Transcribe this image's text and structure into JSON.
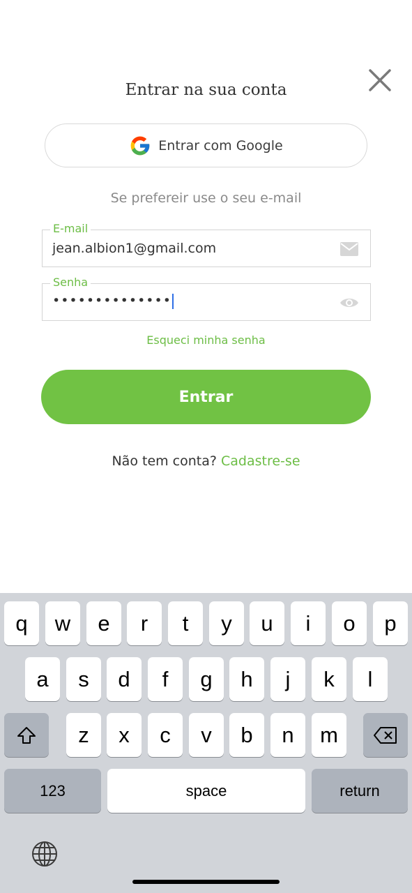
{
  "header": {
    "title": "Entrar na sua conta"
  },
  "google_button": {
    "label": "Entrar com Google"
  },
  "subtitle": "Se prefereir use o seu e-mail",
  "email_field": {
    "label": "E-mail",
    "value": "jean.albion1@gmail.com",
    "icon": "mail-icon"
  },
  "password_field": {
    "label": "Senha",
    "value": "••••••••••••••",
    "icon": "eye-icon"
  },
  "forgot_link": "Esqueci minha senha",
  "submit_button": {
    "label": "Entrar"
  },
  "signup": {
    "prompt": "Não tem conta?",
    "link": "Cadastre-se"
  },
  "colors": {
    "accent": "#71c244",
    "link": "#6cbd45",
    "keyboard_bg": "#d1d4d9"
  },
  "keyboard": {
    "row1": [
      "q",
      "w",
      "e",
      "r",
      "t",
      "y",
      "u",
      "i",
      "o",
      "p"
    ],
    "row2": [
      "a",
      "s",
      "d",
      "f",
      "g",
      "h",
      "j",
      "k",
      "l"
    ],
    "row3": [
      "z",
      "x",
      "c",
      "v",
      "b",
      "n",
      "m"
    ],
    "numbers_label": "123",
    "space_label": "space",
    "return_label": "return"
  }
}
